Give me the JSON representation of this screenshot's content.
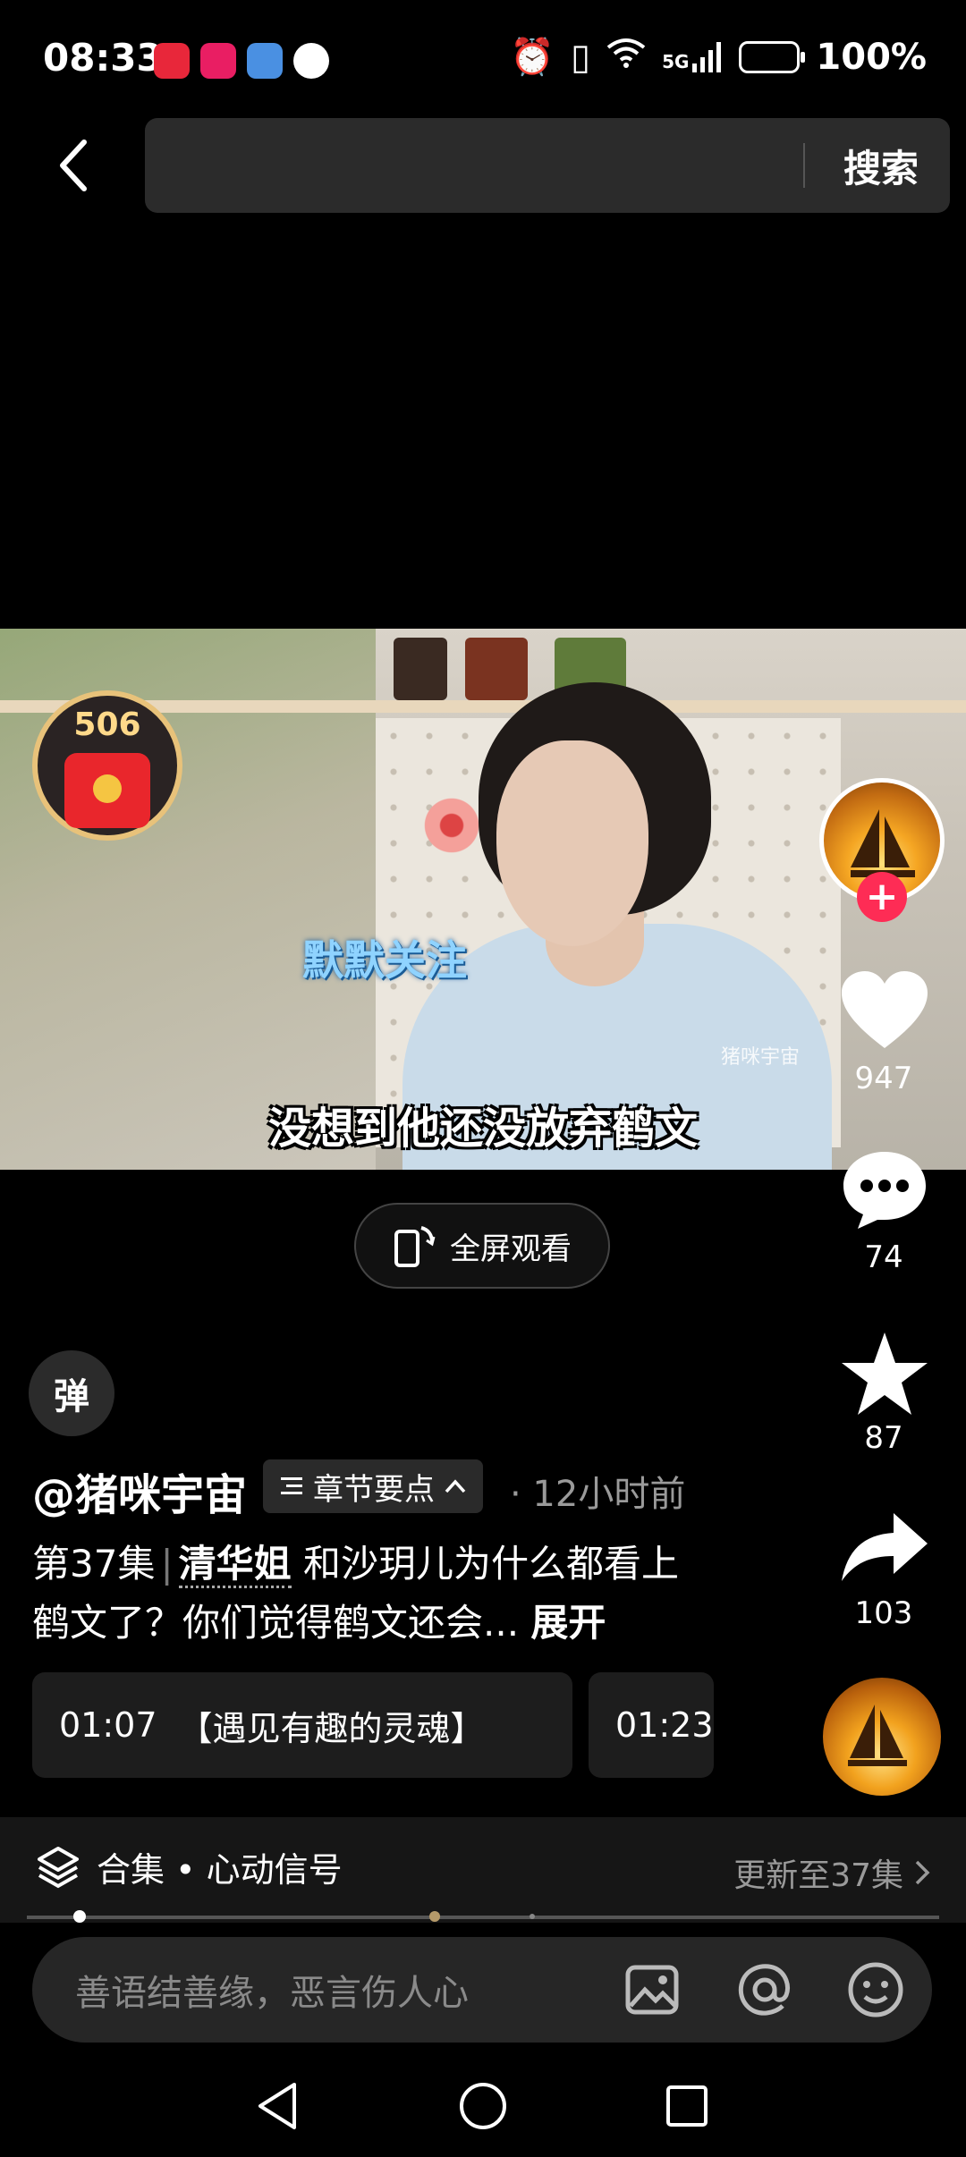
{
  "status_bar": {
    "time": "08:33",
    "battery": "100%",
    "network": "5G",
    "app_icon_colors": [
      "#e8273a",
      "#e91e63",
      "#4a90e2",
      "#ffffff"
    ]
  },
  "top_bar": {
    "search_placeholder": "",
    "search_label": "搜索"
  },
  "video": {
    "caption_blue": "默默关注",
    "subtitle": "没想到他还没放弃鹤文",
    "watermark": "猪咪宇宙",
    "redpack_count": "506",
    "fullscreen_label": "全屏观看"
  },
  "rail": {
    "likes": "947",
    "comments": "74",
    "favorites": "87",
    "shares": "103"
  },
  "danmaku_label": "弹",
  "author": {
    "handle": "@猪咪宇宙",
    "chapter_label": "章节要点",
    "time_ago": "· 12小时前"
  },
  "description": {
    "episode": "第37集",
    "sep": "|",
    "highlight": "清华姐",
    "text": " 和沙玥儿为什么都看上鹤文了？你们觉得鹤文还会...",
    "more": "展开"
  },
  "chapters": [
    {
      "time": "01:07",
      "title": "【遇见有趣的灵魂】"
    },
    {
      "time": "01:23",
      "title": ""
    }
  ],
  "collection": {
    "label": "合集 • 心动信号",
    "update": "更新至37集"
  },
  "comment": {
    "placeholder": "善语结善缘，恶言伤人心"
  },
  "colors": {
    "accent": "#fe2c55",
    "gold": "#e8c27a"
  }
}
